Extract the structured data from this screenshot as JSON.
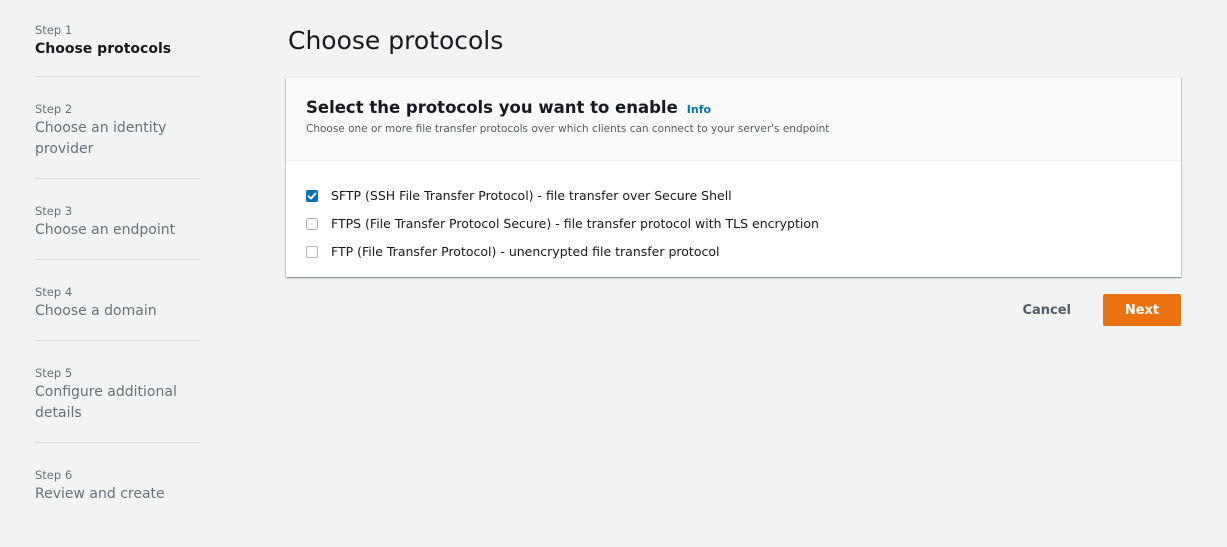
{
  "sidebar": {
    "steps": [
      {
        "number": "Step 1",
        "title": "Choose protocols"
      },
      {
        "number": "Step 2",
        "title": "Choose an identity provider"
      },
      {
        "number": "Step 3",
        "title": "Choose an endpoint"
      },
      {
        "number": "Step 4",
        "title": "Choose a domain"
      },
      {
        "number": "Step 5",
        "title": "Configure additional details"
      },
      {
        "number": "Step 6",
        "title": "Review and create"
      }
    ]
  },
  "main": {
    "page_title": "Choose protocols",
    "container": {
      "title": "Select the protocols you want to enable",
      "info_label": "Info",
      "description": "Choose one or more file transfer protocols over which clients can connect to your server's endpoint",
      "options": [
        {
          "label": "SFTP (SSH File Transfer Protocol) - file transfer over Secure Shell",
          "checked": true
        },
        {
          "label": "FTPS (File Transfer Protocol Secure) - file transfer protocol with TLS encryption",
          "checked": false
        },
        {
          "label": "FTP (File Transfer Protocol) - unencrypted file transfer protocol",
          "checked": false
        }
      ]
    },
    "actions": {
      "cancel_label": "Cancel",
      "next_label": "Next"
    }
  },
  "colors": {
    "accent": "#ec7211",
    "link": "#0073bb",
    "background": "#f2f3f3"
  }
}
